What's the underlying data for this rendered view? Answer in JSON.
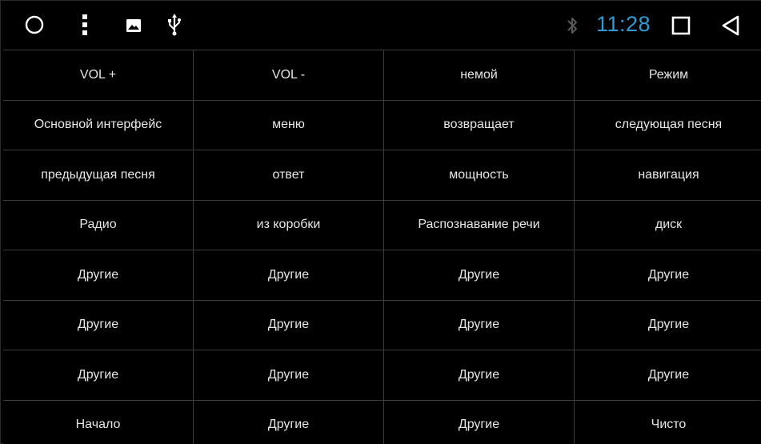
{
  "status_bar": {
    "time": "11:28",
    "time_color": "#2e9bd6",
    "icons": [
      "home-circle-icon",
      "more-vertical-icon",
      "image-icon",
      "usb-icon",
      "bluetooth-icon",
      "recents-square-icon",
      "back-triangle-icon"
    ]
  },
  "grid": {
    "rows": [
      [
        "VOL +",
        "VOL -",
        "немой",
        "Режим"
      ],
      [
        "Основной интерфейс",
        "меню",
        "возвращает",
        "следующая песня"
      ],
      [
        "предыдущая песня",
        "ответ",
        "мощность",
        "навигация"
      ],
      [
        "Радио",
        "из коробки",
        "Распознавание речи",
        "диск"
      ],
      [
        "Другие",
        "Другие",
        "Другие",
        "Другие"
      ],
      [
        "Другие",
        "Другие",
        "Другие",
        "Другие"
      ],
      [
        "Другие",
        "Другие",
        "Другие",
        "Другие"
      ],
      [
        "Начало",
        "Другие",
        "Другие",
        "Чисто"
      ]
    ]
  }
}
